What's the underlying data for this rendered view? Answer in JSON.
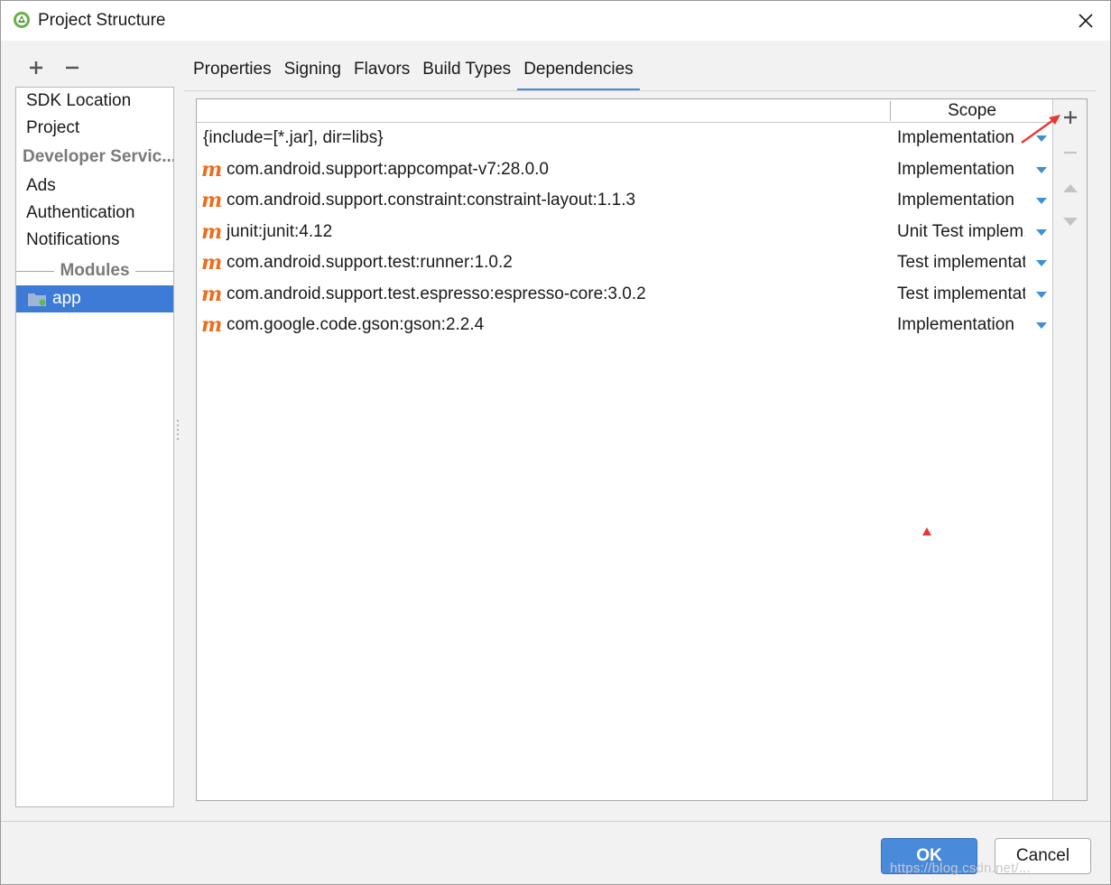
{
  "window": {
    "title": "Project Structure",
    "icon": "android-studio-icon",
    "close_icon": "close-icon"
  },
  "left_toolbar": {
    "add_icon": "plus-icon",
    "remove_icon": "minus-icon"
  },
  "sidebar": {
    "items": [
      {
        "label": "SDK Location",
        "type": "item"
      },
      {
        "label": "Project",
        "type": "item"
      },
      {
        "label": "Developer Servic...",
        "type": "group"
      },
      {
        "label": "Ads",
        "type": "item"
      },
      {
        "label": "Authentication",
        "type": "item"
      },
      {
        "label": "Notifications",
        "type": "item"
      },
      {
        "label": "Modules",
        "type": "separator"
      },
      {
        "label": "app",
        "type": "selected"
      }
    ]
  },
  "tabs": [
    {
      "label": "Properties",
      "active": false
    },
    {
      "label": "Signing",
      "active": false
    },
    {
      "label": "Flavors",
      "active": false
    },
    {
      "label": "Build Types",
      "active": false
    },
    {
      "label": "Dependencies",
      "active": true
    }
  ],
  "table": {
    "scope_header": "Scope",
    "rows": [
      {
        "icon": "",
        "name": "{include=[*.jar], dir=libs}",
        "scope": "Implementation"
      },
      {
        "icon": "m",
        "name": "com.android.support:appcompat-v7:28.0.0",
        "scope": "Implementation"
      },
      {
        "icon": "m",
        "name": "com.android.support.constraint:constraint-layout:1.1.3",
        "scope": "Implementation"
      },
      {
        "icon": "m",
        "name": "junit:junit:4.12",
        "scope": "Unit Test implem..."
      },
      {
        "icon": "m",
        "name": "com.android.support.test:runner:1.0.2",
        "scope": "Test implementat..."
      },
      {
        "icon": "m",
        "name": "com.android.support.test.espresso:espresso-core:3.0.2",
        "scope": "Test implementat..."
      },
      {
        "icon": "m",
        "name": "com.google.code.gson:gson:2.2.4",
        "scope": "Implementation"
      }
    ]
  },
  "side_buttons": {
    "add": "plus-icon",
    "remove": "minus-icon",
    "up": "arrow-up-icon",
    "down": "arrow-down-icon"
  },
  "buttons": {
    "ok": "OK",
    "cancel": "Cancel"
  },
  "watermark": "https://blog.csdn.net/...",
  "colors": {
    "accent": "#3d7bd6",
    "tab_underline": "#4a88d8",
    "maven_icon": "#ee6c1b",
    "dropdown": "#3d8fd6",
    "annotation": "#e53935"
  }
}
